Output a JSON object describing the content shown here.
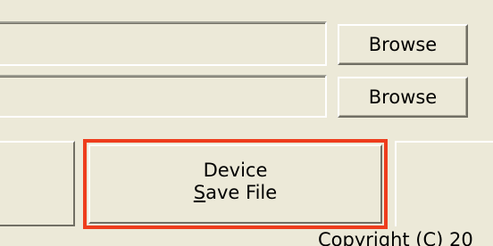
{
  "fields": [
    {
      "value": ""
    },
    {
      "value": ""
    }
  ],
  "buttons": {
    "browse_1": "Browse",
    "browse_2": "Browse",
    "device_save_line1": "Device",
    "device_save_mnemonic": "S",
    "device_save_line2_rest": "ave File"
  },
  "highlight_color": "#ee3d1d",
  "footer": {
    "copyright": "Copyright (C) 20"
  }
}
